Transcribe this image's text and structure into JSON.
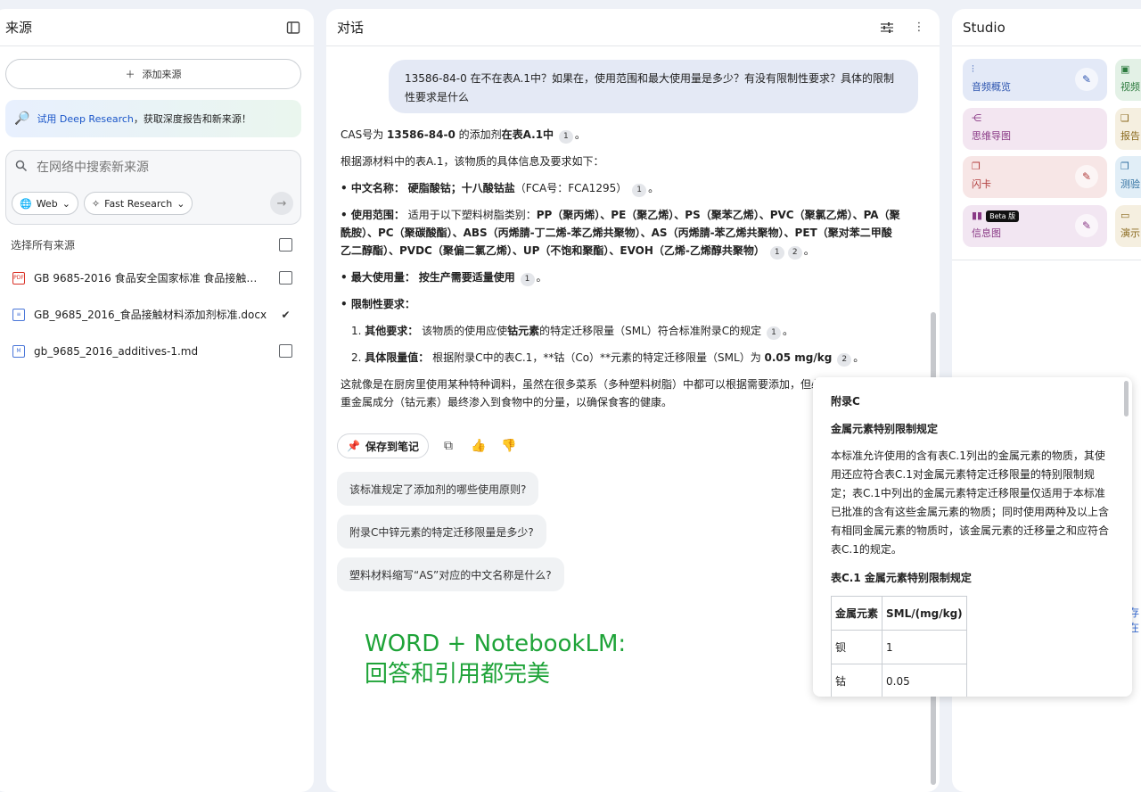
{
  "sources": {
    "title": "来源",
    "add_source": "添加来源",
    "promo_link": "试用 Deep Research",
    "promo_rest": "，获取深度报告和新来源！",
    "search_placeholder": "在网络中搜索新来源",
    "chip_web": "Web",
    "chip_research": "Fast Research",
    "select_all": "选择所有来源",
    "items": [
      {
        "name": "GB 9685-2016 食品安全国家标准 食品接触材料...",
        "checked": false,
        "icon_color": "#d93025"
      },
      {
        "name": "GB_9685_2016_食品接触材料添加剂标准.docx",
        "checked": true,
        "icon_color": "#4a76d8"
      },
      {
        "name": "gb_9685_2016_additives-1.md",
        "checked": false,
        "icon_color": "#4a76d8"
      }
    ]
  },
  "chat": {
    "title": "对话",
    "user_message": "13586-84-0 在不在表A.1中？如果在，使用范围和最大使用量是多少？有没有限制性要求？具体的限制性要求是什么",
    "answer": {
      "l1_pre": "CAS号为 ",
      "l1_cas": "13586-84-0",
      "l1_mid": " 的添加剂",
      "l1_bold": "在表A.1中",
      "l2": "根据源材料中的表A.1，该物质的具体信息及要求如下：",
      "name_label": "• 中文名称：",
      "name_value": "硬脂酸钴；十八酸钴盐",
      "name_fca": "（FCA号：FCA1295）",
      "scope_label": "• 使用范围：",
      "scope_pre": "适用于以下塑料树脂类别：",
      "scope_value": "PP（聚丙烯）、PE（聚乙烯）、PS（聚苯乙烯）、PVC（聚氯乙烯）、PA（聚酰胺）、PC（聚碳酸酯）、ABS（丙烯腈-丁二烯-苯乙烯共聚物）、AS（丙烯腈-苯乙烯共聚物）、PET（聚对苯二甲酸乙二醇酯）、PVDC（聚偏二氯乙烯）、UP（不饱和聚酯）、EVOH（乙烯-乙烯醇共聚物）",
      "max_label": "• 最大使用量：",
      "max_value": "按生产需要适量使用",
      "limit_label": "• 限制性要求：",
      "r1_num": "1. ",
      "r1_label": "其他要求：",
      "r1_pre": "该物质的使用应使",
      "r1_bold": "钴元素",
      "r1_post": "的特定迁移限量（SML）符合标准附录C的规定",
      "r2_num": "2. ",
      "r2_label": "具体限量值：",
      "r2_pre": "根据附录C中的表C.1，**钴（Co）**元素的特定迁移限量（SML）为 ",
      "r2_bold": "0.05 mg/kg",
      "summary": "这就像是在厨房里使用某种特种调料，虽然在很多菜系（多种塑料树脂）中都可以根据需要添加，但必须严格控制其中重金属成分（钴元素）最终渗入到食物中的分量，以确保食客的健康。",
      "cite1": "1",
      "cite2": "2",
      "period": "。"
    },
    "save_note": "保存到笔记",
    "suggestions": [
      "该标准规定了添加剂的哪些使用原则?",
      "附录C中锌元素的特定迁移限量是多少?",
      "塑料材料缩写“AS”对应的中文名称是什么?"
    ],
    "overlay_line1": "WORD + NotebookLM:",
    "overlay_line2": "回答和引用都完美"
  },
  "studio": {
    "title": "Studio",
    "cards": [
      {
        "label": "音频概览",
        "bg": "#e3e9f7",
        "fg": "#2f56b0"
      },
      {
        "label": "思维导图",
        "bg": "#f3e6f1",
        "fg": "#8a3a86"
      },
      {
        "label": "闪卡",
        "bg": "#f7e6e6",
        "fg": "#b13c3c"
      },
      {
        "label": "信息图",
        "bg": "#f2e6f2",
        "fg": "#8a3a86",
        "beta": "Beta 版"
      }
    ],
    "side_cards": [
      {
        "label": "视频",
        "bg": "#e3f1e6",
        "fg": "#2b7a3d"
      },
      {
        "label": "报告",
        "bg": "#f5efe0",
        "fg": "#8a6a1e"
      },
      {
        "label": "测验",
        "bg": "#e1eef7",
        "fg": "#2f6fa0"
      },
      {
        "label": "演示",
        "bg": "#f5efe0",
        "fg": "#8a6a1e"
      }
    ],
    "edge_text": "存在"
  },
  "popup": {
    "title": "附录C",
    "subtitle": "金属元素特别限制规定",
    "body": "本标准允许使用的含有表C.1列出的金属元素的物质，其使用还应符合表C.1对金属元素特定迁移限量的特别限制规定；表C.1中列出的金属元素特定迁移限量仅适用于本标准已批准的含有这些金属元素的物质；同时使用两种及以上含有相同金属元素的物质时，该金属元素的迁移量之和应符合表C.1的规定。",
    "table_title": "表C.1 金属元素特别限制规定",
    "table_headers": [
      "金属元素",
      "SML/(mg/kg)"
    ],
    "table_rows": [
      [
        "钡",
        "1"
      ],
      [
        "钴",
        "0.05"
      ]
    ]
  }
}
